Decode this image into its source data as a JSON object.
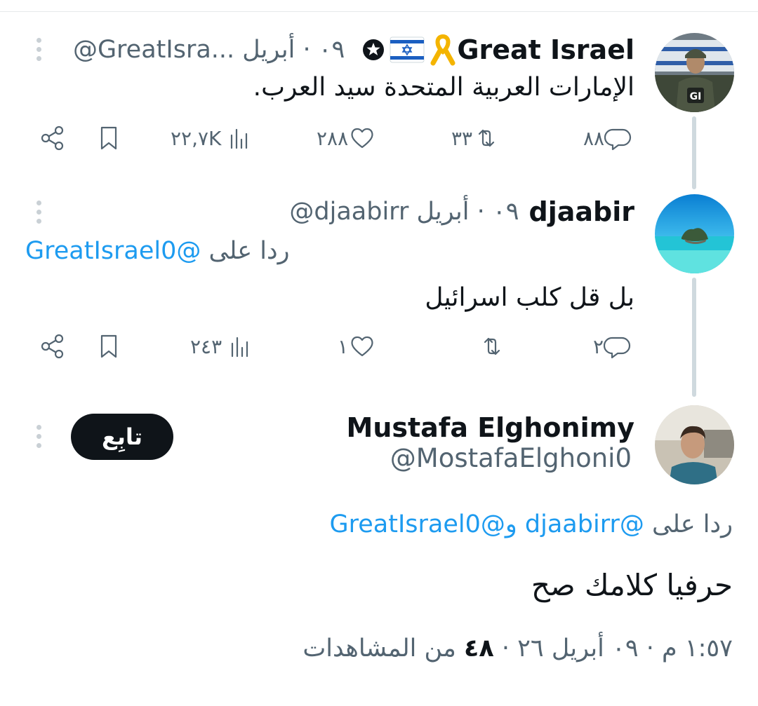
{
  "tweets": [
    {
      "name": "Great Israel",
      "handle": "@GreatIsra...",
      "date_sep": "٠٩ · أبريل",
      "text": "الإمارات العربية المتحدة سيد العرب.",
      "reply_count": "٨٨",
      "retweet_count": "٣٣",
      "like_count": "٢٨٨",
      "view_count": "٢٢,٧K"
    },
    {
      "name": "djaabir",
      "handle": "@djaabirr",
      "date_sep": "٠٩ · أبريل",
      "replying_prefix": "ردا على",
      "replying_to": "@GreatIsrael0",
      "text": "بل قل كلب اسرائيل",
      "reply_count": "٢",
      "retweet_count": "",
      "like_count": "١",
      "view_count": "٢٤٣"
    }
  ],
  "main": {
    "name": "Mustafa Elghonimy",
    "handle": "@MostafaElghoni0",
    "follow_label": "تابِع",
    "replying_prefix": "ردا على",
    "replying_to_1": "@djaabirr",
    "replying_and": " و",
    "replying_to_2": "@GreatIsrael0",
    "text": "حرفيا كلامك صح",
    "timestamp": "١:٥٧ م · ٠٩ أبريل ٢٦ · ",
    "views_number": "٤٨",
    "views_label": " من المشاهدات"
  },
  "colors": {
    "link": "#1d9bf0",
    "secondary_text": "#536471",
    "primary_text": "#0f1419",
    "follow_button": "#0f1419"
  },
  "icons": {
    "reply": "reply-icon",
    "retweet": "retweet-icon",
    "like": "heart-icon",
    "views": "views-icon",
    "bookmark": "bookmark-icon",
    "share": "share-icon",
    "more": "more-icon",
    "yellow_ribbon": "yellow-ribbon-icon",
    "israel_flag": "israel-flag-icon",
    "star_badge": "star-badge-icon"
  }
}
